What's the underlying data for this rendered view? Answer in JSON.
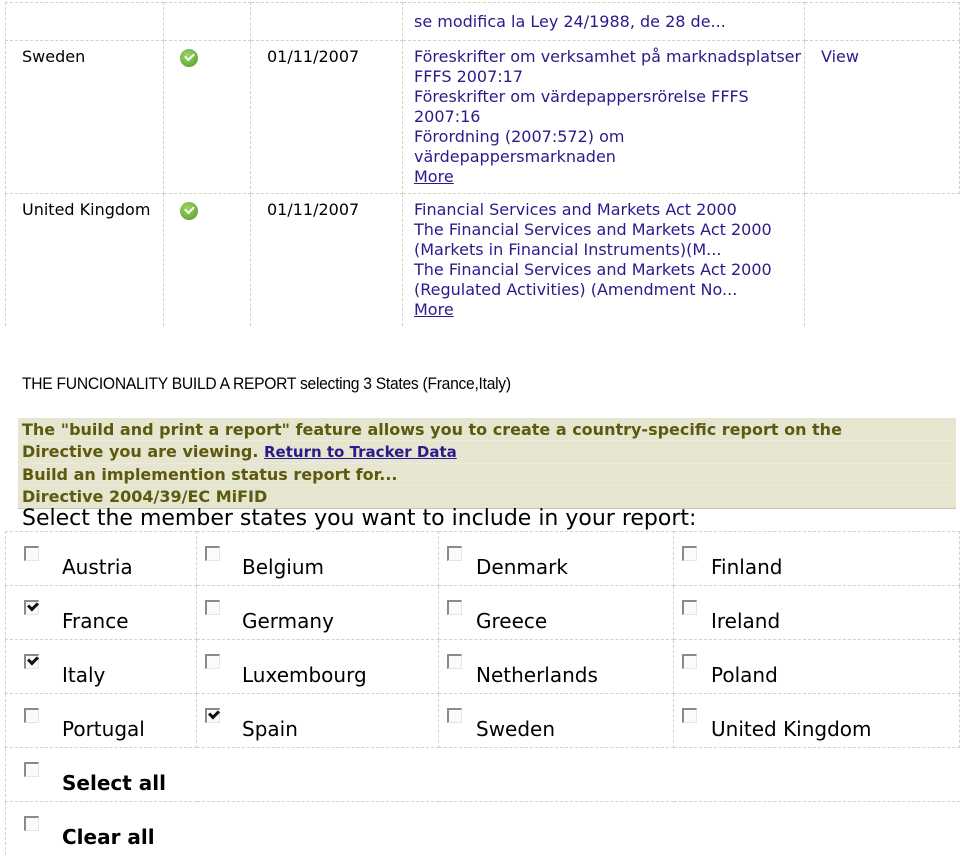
{
  "tracker": {
    "rows": [
      {
        "country": "",
        "status": "",
        "date": "",
        "laws": [
          "se modifica la Ley 24/1988, de 28 de..."
        ],
        "more": "",
        "view": ""
      },
      {
        "country": "Sweden",
        "status": "implemented",
        "date": "01/11/2007",
        "laws": [
          "Föreskrifter om verksamhet på marknadsplatser FFFS 2007:17",
          "Föreskrifter om värdepappersrörelse FFFS 2007:16",
          "Förordning (2007:572) om värdepappersmarknaden"
        ],
        "more": "More",
        "view": "View"
      },
      {
        "country": "United Kingdom",
        "status": "implemented",
        "date": "01/11/2007",
        "laws": [
          "Financial Services and Markets Act 2000",
          "The Financial Services and Markets Act 2000 (Markets in Financial Instruments)(M...",
          "The Financial Services and Markets Act 2000 (Regulated Activities) (Amendment No..."
        ],
        "more": "More",
        "view": ""
      }
    ]
  },
  "caption": "THE FUNCIONALITY BUILD A REPORT selecting 3 States (France,Italy)",
  "info": {
    "intro": "The \"build and print a report\" feature allows you to create a country-specific report on the",
    "intro2": "Directive you are viewing.",
    "return_link": "Return to Tracker Data",
    "build_line": "Build an implemention status report for...",
    "directive": "Directive 2004/39/EC MiFID"
  },
  "select_title": "Select the member states you want to include in your report:",
  "states": [
    [
      {
        "label": "Austria",
        "checked": false
      },
      {
        "label": "Belgium",
        "checked": false
      },
      {
        "label": "Denmark",
        "checked": false
      },
      {
        "label": "Finland",
        "checked": false
      }
    ],
    [
      {
        "label": "France",
        "checked": true
      },
      {
        "label": "Germany",
        "checked": false
      },
      {
        "label": "Greece",
        "checked": false
      },
      {
        "label": "Ireland",
        "checked": false
      }
    ],
    [
      {
        "label": "Italy",
        "checked": true
      },
      {
        "label": "Luxembourg",
        "checked": false
      },
      {
        "label": "Netherlands",
        "checked": false
      },
      {
        "label": "Poland",
        "checked": false
      }
    ],
    [
      {
        "label": "Portugal",
        "checked": false
      },
      {
        "label": "Spain",
        "checked": true
      },
      {
        "label": "Sweden",
        "checked": false
      },
      {
        "label": "United Kingdom",
        "checked": false
      }
    ]
  ],
  "actions": {
    "select_all": {
      "label": "Select all",
      "checked": false
    },
    "clear_all": {
      "label": "Clear all",
      "checked": false
    }
  },
  "colors": {
    "link": "#2b1a8c",
    "info_bg": "#e6e5cf",
    "info_text": "#5c5a0e",
    "grid_border": "#d6d2c0",
    "status_ok": "#6db33f"
  }
}
